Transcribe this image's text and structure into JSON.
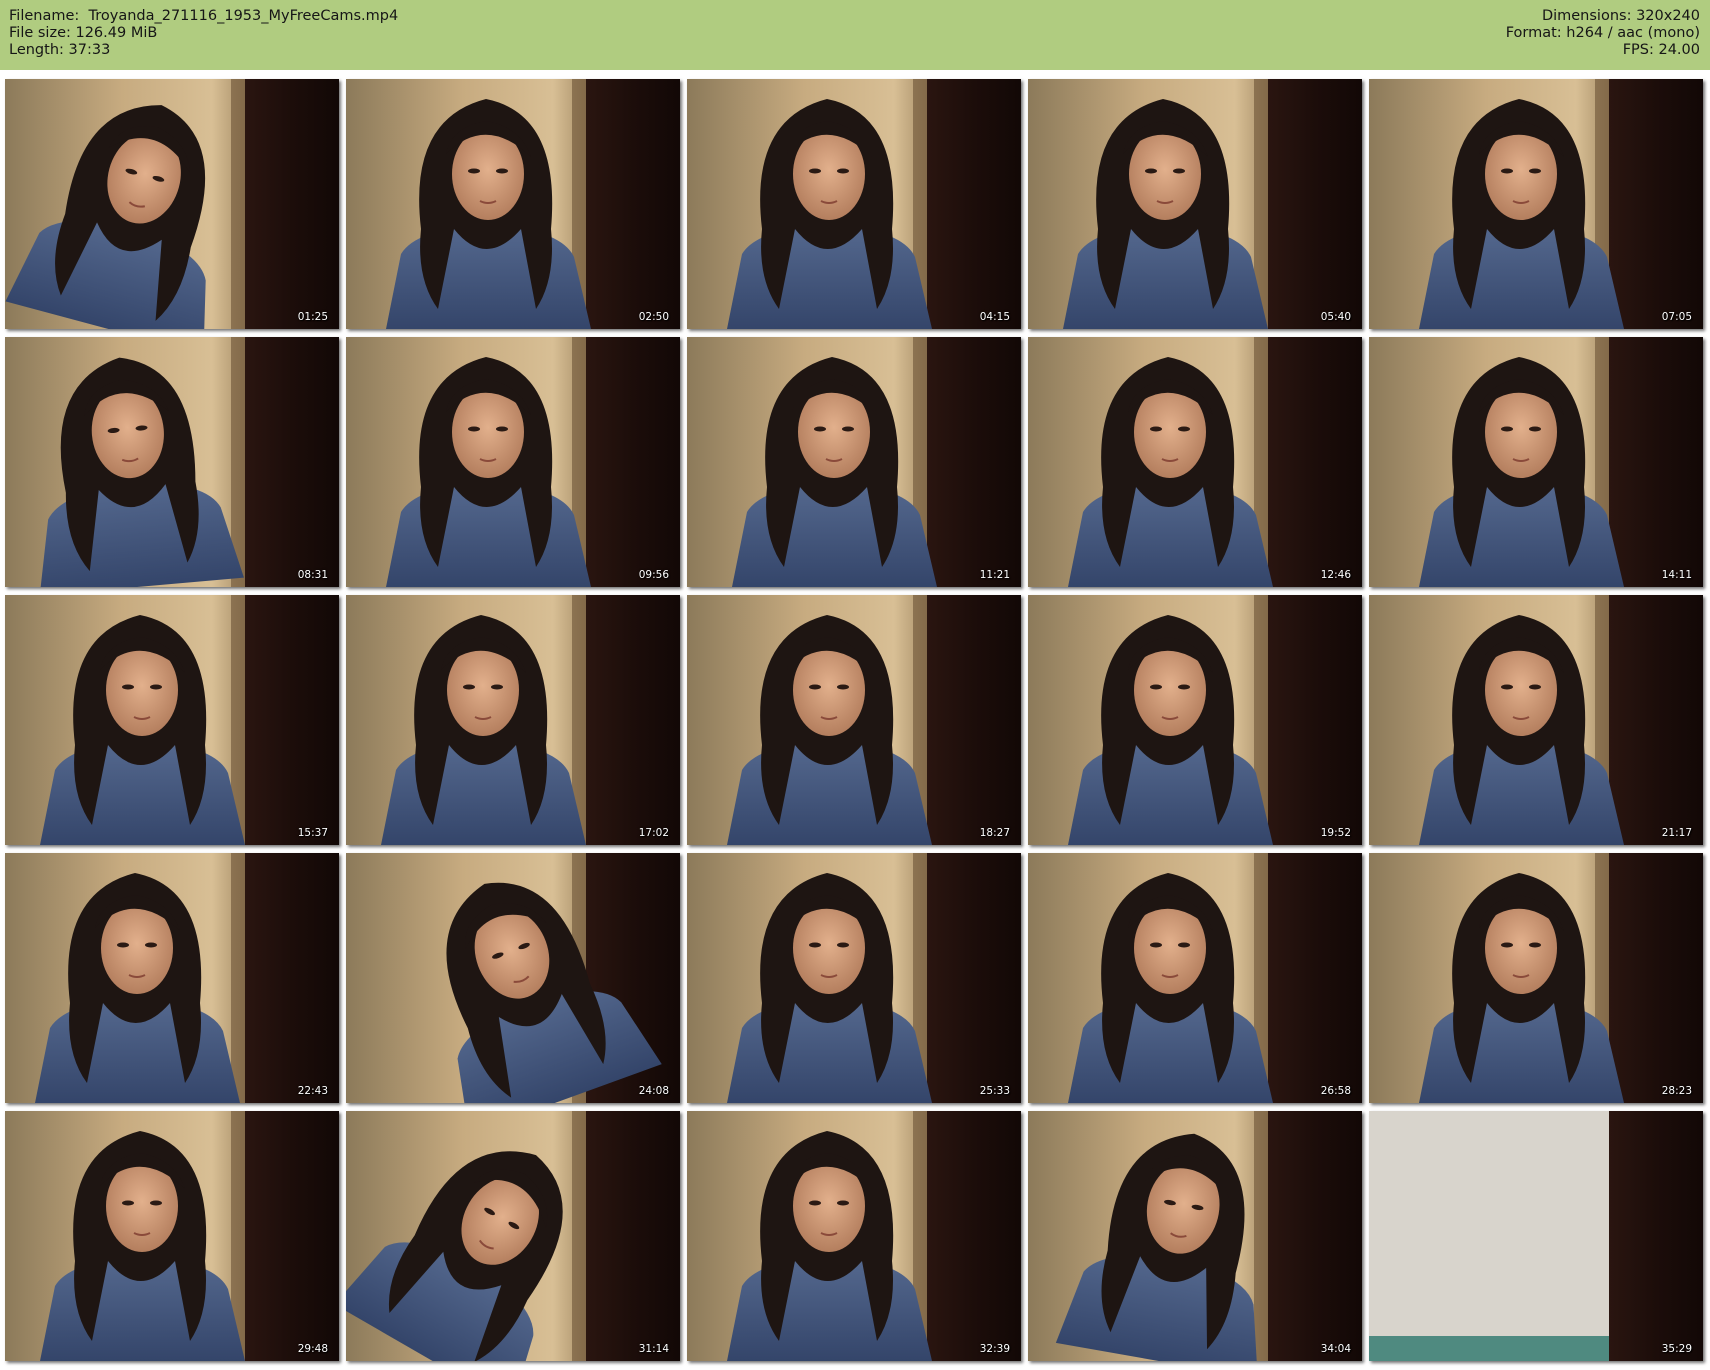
{
  "header": {
    "filename_label": "Filename:",
    "filename_value": "Troyanda_271116_1953_MyFreeCams.mp4",
    "filesize_label": "File size:",
    "filesize_value": "126.49 MiB",
    "length_label": "Length:",
    "length_value": "37:33",
    "dimensions_label": "Dimensions:",
    "dimensions_value": "320x240",
    "format_label": "Format:",
    "format_value": "h264 / aac (mono)",
    "fps_label": "FPS:",
    "fps_value": "24.00",
    "background_color": "#b0cc80"
  },
  "thumbnails": [
    {
      "timestamp": "01:25"
    },
    {
      "timestamp": "02:50"
    },
    {
      "timestamp": "04:15"
    },
    {
      "timestamp": "05:40"
    },
    {
      "timestamp": "07:05"
    },
    {
      "timestamp": "08:31"
    },
    {
      "timestamp": "09:56"
    },
    {
      "timestamp": "11:21"
    },
    {
      "timestamp": "12:46"
    },
    {
      "timestamp": "14:11"
    },
    {
      "timestamp": "15:37"
    },
    {
      "timestamp": "17:02"
    },
    {
      "timestamp": "18:27"
    },
    {
      "timestamp": "19:52"
    },
    {
      "timestamp": "21:17"
    },
    {
      "timestamp": "22:43"
    },
    {
      "timestamp": "24:08"
    },
    {
      "timestamp": "25:33"
    },
    {
      "timestamp": "26:58"
    },
    {
      "timestamp": "28:23"
    },
    {
      "timestamp": "29:48"
    },
    {
      "timestamp": "31:14"
    },
    {
      "timestamp": "32:39"
    },
    {
      "timestamp": "34:04"
    },
    {
      "timestamp": "35:29"
    }
  ]
}
